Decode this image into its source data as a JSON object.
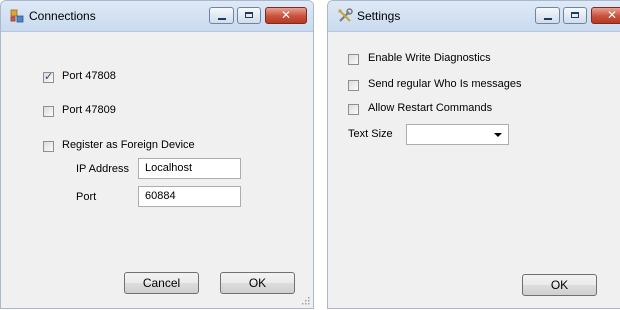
{
  "connections": {
    "title": "Connections",
    "checkbox_47808": {
      "label": "Port 47808",
      "checked": true
    },
    "checkbox_47809": {
      "label": "Port 47809",
      "checked": false
    },
    "checkbox_foreign": {
      "label": "Register as Foreign Device",
      "checked": false
    },
    "ip_label": "IP Address",
    "ip_value": "Localhost",
    "port_label": "Port",
    "port_value": "60884",
    "cancel_label": "Cancel",
    "ok_label": "OK"
  },
  "settings": {
    "title": "Settings",
    "checkbox_diagnostics": {
      "label": "Enable Write Diagnostics",
      "checked": false
    },
    "checkbox_whois": {
      "label": "Send regular Who Is messages",
      "checked": false
    },
    "checkbox_restart": {
      "label": "Allow Restart Commands",
      "checked": false
    },
    "text_size_label": "Text Size",
    "text_size_value": "",
    "ok_label": "OK"
  },
  "icons": {
    "connections_app": "connections-icon",
    "settings_app": "settings-tools-icon",
    "minimize": "minimize-icon",
    "maximize": "maximize-icon",
    "close": "close-icon",
    "checkmark": "checkmark-icon",
    "dropdown": "chevron-down-icon",
    "resize_grip": "resize-grip-icon"
  },
  "colors": {
    "titlebar_top": "#dfe9f6",
    "titlebar_bottom": "#c9daef",
    "client_bg": "#f0f0f0",
    "close_button": "#c9503a"
  }
}
